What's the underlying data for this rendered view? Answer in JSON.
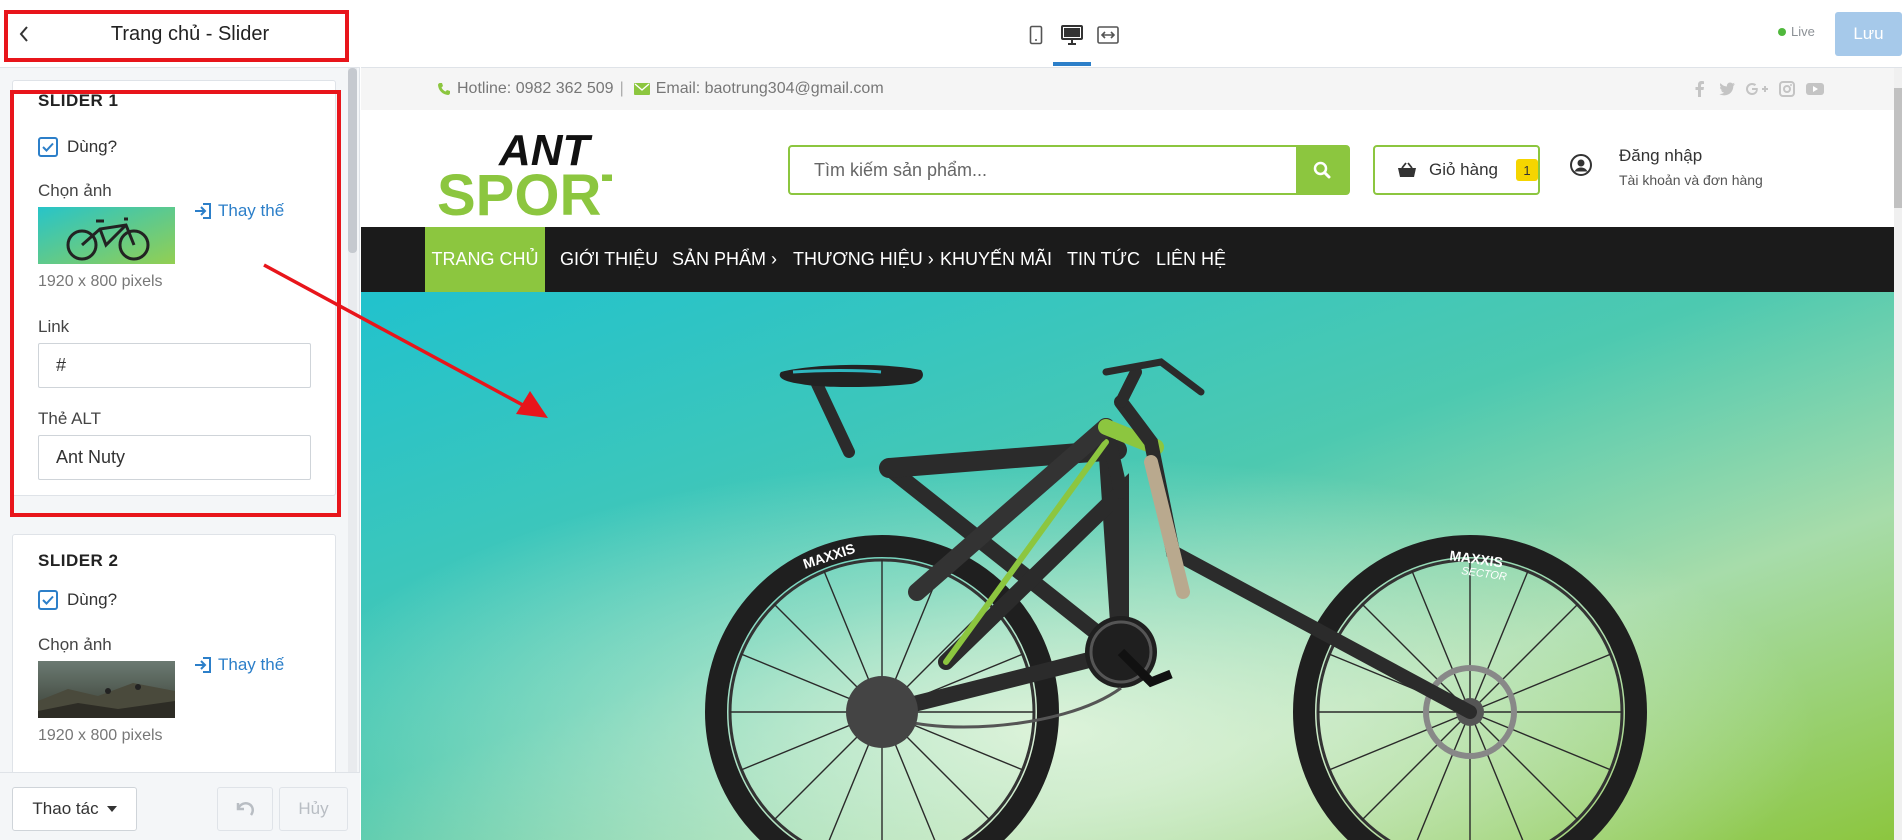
{
  "editor": {
    "title": "Trang chủ - Slider",
    "sliders": [
      {
        "title": "SLIDER 1",
        "enabled_label": "Dùng?",
        "image_label": "Chọn ảnh",
        "replace_label": "Thay thế",
        "dimensions": "1920 x 800 pixels",
        "link_label": "Link",
        "link_value": "#",
        "alt_label": "Thẻ ALT",
        "alt_value": "Ant Nuty"
      },
      {
        "title": "SLIDER 2",
        "enabled_label": "Dùng?",
        "image_label": "Chọn ảnh",
        "replace_label": "Thay thế",
        "dimensions": "1920 x 800 pixels"
      }
    ],
    "footer": {
      "actions_label": "Thao tác",
      "cancel_label": "Hủy"
    }
  },
  "toolbar": {
    "live_label": "Live",
    "save_label": "Lưu"
  },
  "site": {
    "hotline": "Hotline: 0982 362 509",
    "separator": "|",
    "email": "Email: baotrung304@gmail.com",
    "logo_top": "ANT",
    "logo_bottom": "SPORT",
    "search_placeholder": "Tìm kiếm sản phẩm...",
    "cart_label": "Giỏ hàng",
    "cart_count": "1",
    "login_label": "Đăng nhập",
    "account_sub": "Tài khoản và đơn hàng",
    "nav": [
      "TRANG CHỦ",
      "GIỚI THIỆU",
      "SẢN PHẨM ›",
      "THƯƠNG HIỆU ›",
      "KHUYẾN MÃI",
      "TIN TỨC",
      "LIÊN HỆ"
    ],
    "hero_tire_brand": "MAXXIS",
    "hero_tire_model": "SECTOR"
  },
  "colors": {
    "brand_green": "#8cc63f",
    "nav_bg": "#1b1b1b",
    "highlight_red": "#e8151b",
    "link_blue": "#2c7fc9"
  }
}
